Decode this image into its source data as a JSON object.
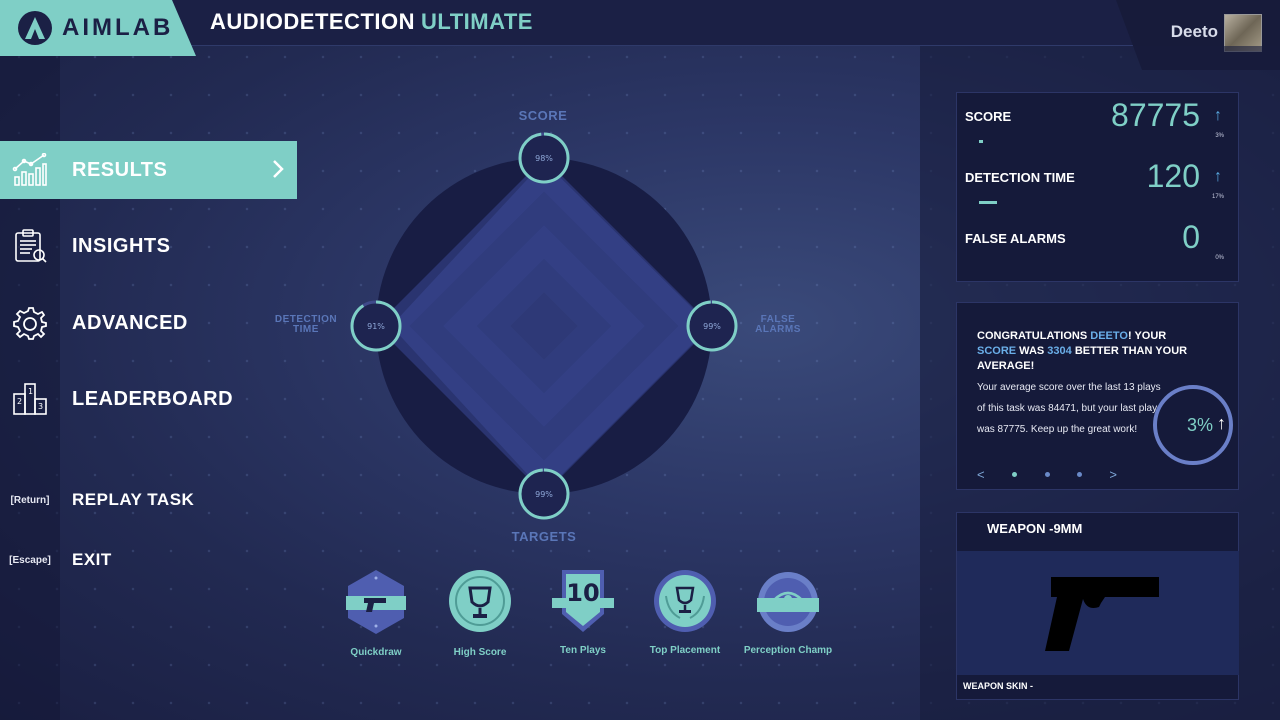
{
  "app": {
    "logo_text": "AIMLAB",
    "title_main": "AUDIODETECTION",
    "title_accent": "ULTIMATE"
  },
  "user": {
    "name": "Deeto"
  },
  "nav": {
    "items": [
      {
        "label": "RESULTS",
        "icon": "chart-icon",
        "active": true
      },
      {
        "label": "INSIGHTS",
        "icon": "clipboard-icon",
        "active": false
      },
      {
        "label": "ADVANCED",
        "icon": "gear-icon",
        "active": false
      },
      {
        "label": "LEADERBOARD",
        "icon": "podium-icon",
        "active": false
      }
    ],
    "replay": {
      "key": "[Return]",
      "label": "REPLAY TASK"
    },
    "exit": {
      "key": "[Escape]",
      "label": "EXIT"
    }
  },
  "radar": {
    "labels": {
      "top": "SCORE",
      "left_1": "DETECTION",
      "left_2": "TIME",
      "right_1": "FALSE",
      "right_2": "ALARMS",
      "bottom": "TARGETS"
    },
    "percents": {
      "score": "98%",
      "detection_time": "91%",
      "false_alarms": "99%",
      "targets": "99%"
    },
    "values": {
      "score": 0.98,
      "detection_time": 0.91,
      "false_alarms": 0.99,
      "targets": 0.99
    }
  },
  "badges": [
    {
      "label": "Quickdraw",
      "icon": "pistol-badge-icon"
    },
    {
      "label": "High Score",
      "icon": "trophy-badge-icon"
    },
    {
      "label": "Ten Plays",
      "icon": "ten-badge-icon",
      "number": "10"
    },
    {
      "label": "Top Placement",
      "icon": "trophy-wreath-badge-icon"
    },
    {
      "label": "Perception Champ",
      "icon": "eye-badge-icon"
    }
  ],
  "stats": [
    {
      "label": "SCORE",
      "value": "87775",
      "pct": "3%",
      "bar": 0.05
    },
    {
      "label": "DETECTION TIME",
      "value": "120",
      "pct": "17%",
      "bar": 0.3
    },
    {
      "label": "FALSE ALARMS",
      "value": "0",
      "pct": "0%",
      "bar": 0
    }
  ],
  "congrats": {
    "head_1": "CONGRATULATIONS ",
    "head_name": "DEETO",
    "head_2": "! YOUR ",
    "head_score": "SCORE",
    "head_3": " WAS ",
    "head_diff": "3304",
    "head_4": " BETTER THAN YOUR AVERAGE!",
    "body": "Your average score over the last 13 plays of this task was 84471, but your last play was 87775. Keep up the great work!",
    "ring_pct": "3%",
    "prev": "<",
    "next": ">"
  },
  "weapon": {
    "title": "WEAPON -9MM",
    "skin": "WEAPON SKIN -"
  },
  "colors": {
    "accent": "#7fcfc6",
    "panel": "#151a3a",
    "header": "#1b2045",
    "radar_dark": "#181d44",
    "radar_mid": "#2c3672"
  }
}
